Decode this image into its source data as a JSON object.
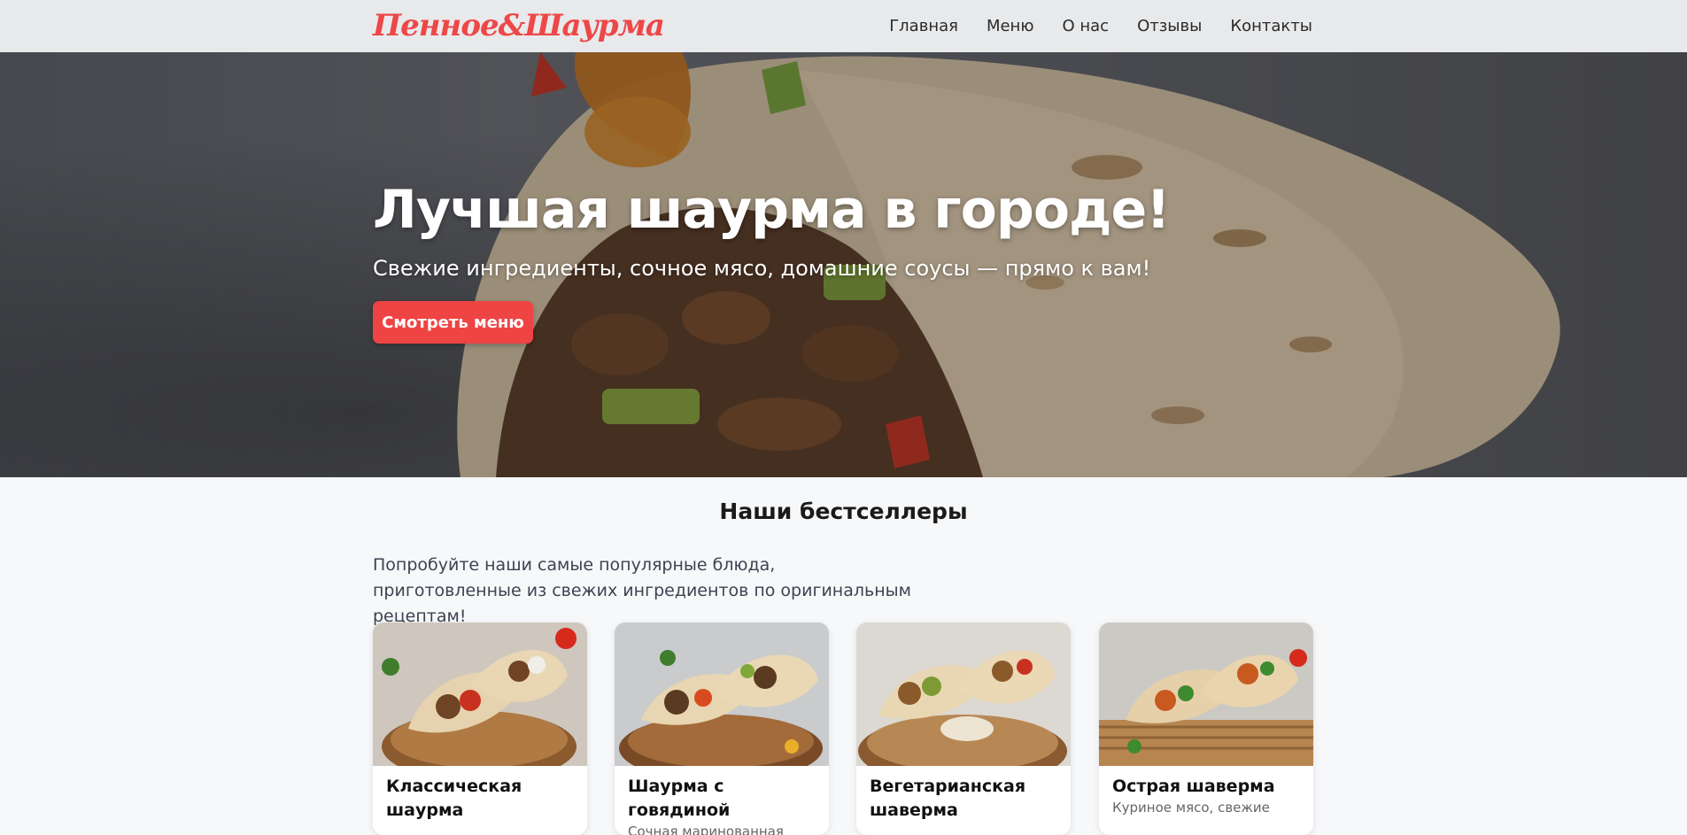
{
  "site": {
    "logo": "Пенное&Шаурма",
    "brand_color": "#ef4444"
  },
  "nav": {
    "items": [
      "Главная",
      "Меню",
      "О нас",
      "Отзывы",
      "Контакты"
    ]
  },
  "hero": {
    "title": "Лучшая шаурма в городе!",
    "subtitle": "Свежие ингредиенты, сочное мясо, домашние соусы — прямо к вам!",
    "cta_label": "Смотреть меню"
  },
  "bestsellers": {
    "title": "Наши бестселлеры",
    "description": "Попробуйте наши самые популярные блюда, приготовленные из свежих ингредиентов по оригинальным рецептам!",
    "cards": [
      {
        "title": "Классическая шаурма",
        "text": ""
      },
      {
        "title": "Шаурма с говядиной",
        "text": "Сочная маринованная"
      },
      {
        "title": "Вегетарианская шаверма",
        "text": ""
      },
      {
        "title": "Острая шаверма",
        "text": "Куриное мясо, свежие"
      }
    ]
  }
}
